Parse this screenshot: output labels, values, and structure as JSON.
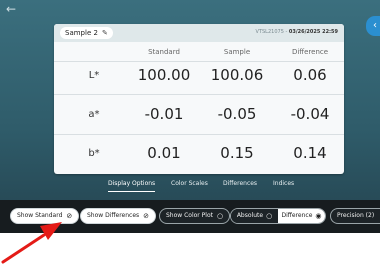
{
  "header": {
    "sample_label": "Sample 2",
    "meta_prefix": "VTSL21075 - ",
    "meta_datetime": "03/26/2025 22:59"
  },
  "table": {
    "columns": [
      "Standard",
      "Sample",
      "Difference"
    ],
    "rows": [
      {
        "label": "L*",
        "values": [
          "100.00",
          "100.06",
          "0.06"
        ]
      },
      {
        "label": "a*",
        "values": [
          "-0.01",
          "-0.05",
          "-0.04"
        ]
      },
      {
        "label": "b*",
        "values": [
          "0.01",
          "0.15",
          "0.14"
        ]
      }
    ]
  },
  "tabs": [
    {
      "label": "Display Options",
      "active": true
    },
    {
      "label": "Color Scales",
      "active": false
    },
    {
      "label": "Differences",
      "active": false
    },
    {
      "label": "Indices",
      "active": false
    }
  ],
  "toolbar": {
    "show_standard": "Show Standard",
    "show_differences": "Show Differences",
    "show_color_plot": "Show Color Plot",
    "absolute": "Absolute",
    "difference": "Difference",
    "precision": "Precision (2)"
  },
  "colors": {
    "background": "#2f5c6a",
    "toolbar": "#171c1f",
    "annotation_arrow": "#e41b17"
  }
}
